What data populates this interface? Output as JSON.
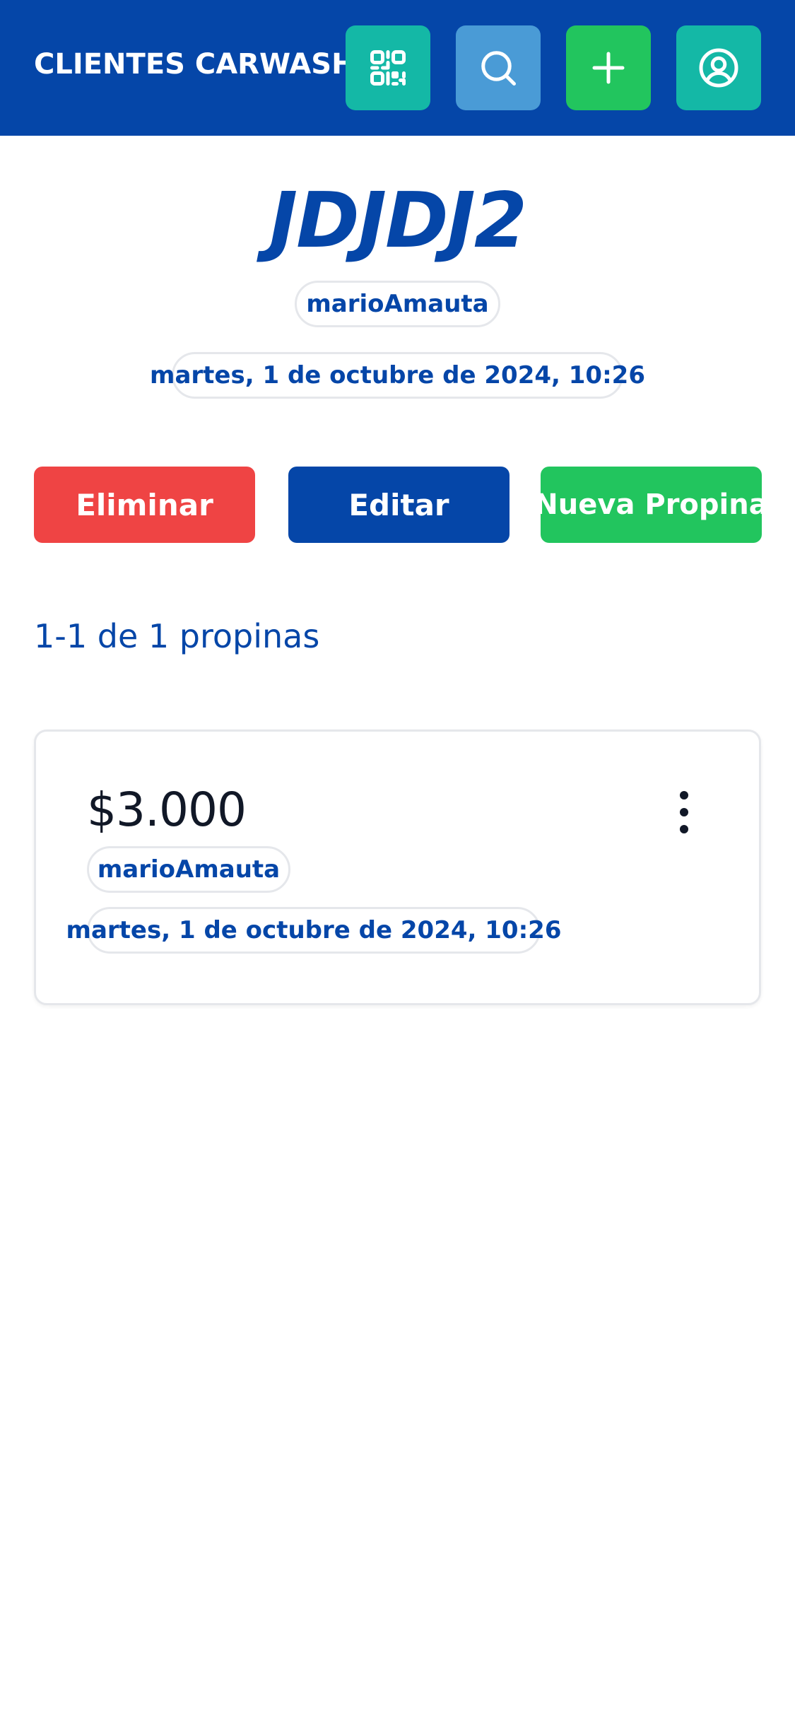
{
  "header": {
    "title": "CLIENTES CARWASH",
    "buttons": [
      {
        "name": "qr-code",
        "icon": "qr-code-icon",
        "color": "#14b8a6"
      },
      {
        "name": "search",
        "icon": "search-icon",
        "color": "#4a9bd6"
      },
      {
        "name": "add",
        "icon": "plus-icon",
        "color": "#22c55e"
      },
      {
        "name": "profile",
        "icon": "user-circle-icon",
        "color": "#14b8a6"
      }
    ],
    "background": "#0546a8"
  },
  "vehicle": {
    "plate": "JDJDJ2",
    "user": "marioAmauta",
    "date": "martes, 1 de octubre de 2024, 10:26"
  },
  "actions": {
    "delete_label": "Eliminar",
    "edit_label": "Editar",
    "new_tip_label": "Nueva Propina"
  },
  "tips": {
    "count_label": "1-1 de 1 propinas",
    "items": [
      {
        "amount": "$3.000",
        "user": "marioAmauta",
        "date": "martes, 1 de octubre de 2024, 10:26",
        "menu_icon": "more-vertical-icon"
      }
    ]
  },
  "colors": {
    "primary": "#0546a8",
    "danger": "#ef4444",
    "success": "#22c55e",
    "teal": "#14b8a6"
  }
}
